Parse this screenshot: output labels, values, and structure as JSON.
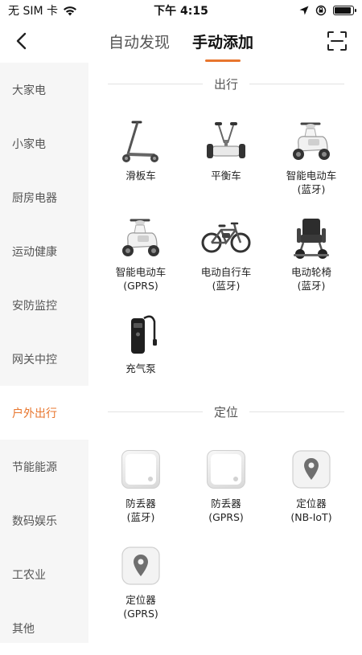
{
  "status_bar": {
    "carrier": "无 SIM 卡",
    "time": "下午 4:15",
    "battery_level": 0.9
  },
  "header": {
    "tabs": [
      {
        "label": "自动发现",
        "active": false
      },
      {
        "label": "手动添加",
        "active": true
      }
    ],
    "accent_color": "#e8762e"
  },
  "sidebar": {
    "items": [
      {
        "label": "大家电"
      },
      {
        "label": "小家电"
      },
      {
        "label": "厨房电器"
      },
      {
        "label": "运动健康"
      },
      {
        "label": "安防监控"
      },
      {
        "label": "网关中控"
      },
      {
        "label": "户外出行",
        "active": true
      },
      {
        "label": "节能能源"
      },
      {
        "label": "数码娱乐"
      },
      {
        "label": "工农业"
      },
      {
        "label": "其他"
      }
    ]
  },
  "sections": [
    {
      "title": "出行",
      "devices": [
        {
          "line1": "滑板车",
          "line2": "",
          "icon": "scooter-icon"
        },
        {
          "line1": "平衡车",
          "line2": "",
          "icon": "balance-board-icon"
        },
        {
          "line1": "智能电动车",
          "line2": "(蓝牙)",
          "icon": "e-moped-icon"
        },
        {
          "line1": "智能电动车",
          "line2": "(GPRS)",
          "icon": "e-moped-icon"
        },
        {
          "line1": "电动自行车",
          "line2": "(蓝牙)",
          "icon": "e-bike-icon"
        },
        {
          "line1": "电动轮椅",
          "line2": "(蓝牙)",
          "icon": "wheelchair-icon"
        },
        {
          "line1": "充气泵",
          "line2": "",
          "icon": "air-pump-icon"
        }
      ]
    },
    {
      "title": "定位",
      "devices": [
        {
          "line1": "防丢器",
          "line2": "(蓝牙)",
          "icon": "tracker-tag-icon"
        },
        {
          "line1": "防丢器",
          "line2": "(GPRS)",
          "icon": "tracker-tag-icon"
        },
        {
          "line1": "定位器",
          "line2": "(NB-IoT)",
          "icon": "locator-pin-icon"
        },
        {
          "line1": "定位器",
          "line2": "(GPRS)",
          "icon": "locator-pin-icon"
        }
      ]
    }
  ]
}
